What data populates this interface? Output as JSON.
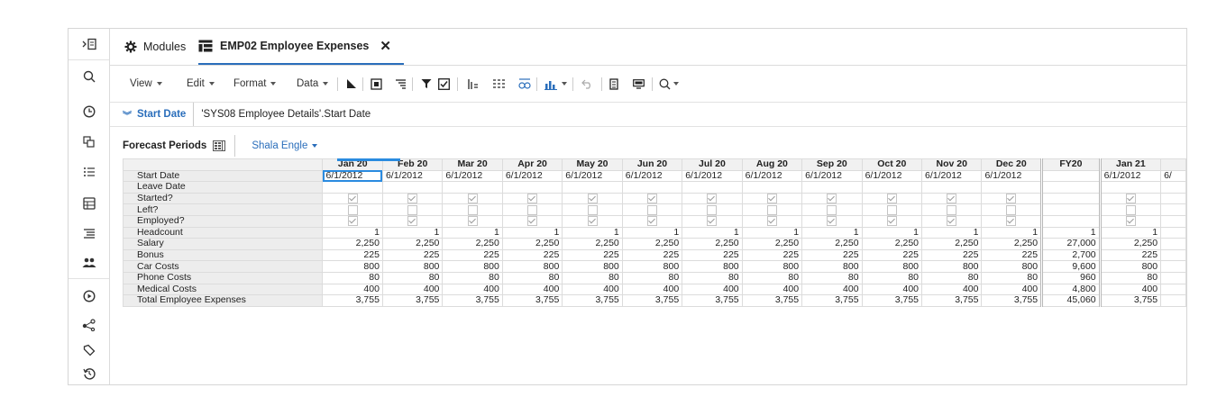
{
  "tabs": [
    {
      "label": "Modules",
      "icon": "gear-icon",
      "active": false
    },
    {
      "label": "EMP02 Employee Expenses",
      "icon": "grid-icon",
      "active": true
    }
  ],
  "toolbar": {
    "menus": [
      "View",
      "Edit",
      "Format",
      "Data"
    ]
  },
  "filter": {
    "label": "Start Date",
    "value": "'SYS08 Employee Details'.Start Date"
  },
  "pagebar": {
    "title": "Forecast Periods",
    "selector": "Shala Engle"
  },
  "grid": {
    "columns": [
      "Jan 20",
      "Feb 20",
      "Mar 20",
      "Apr 20",
      "May 20",
      "Jun 20",
      "Jul 20",
      "Aug 20",
      "Sep 20",
      "Oct 20",
      "Nov 20",
      "Dec 20",
      "FY20",
      "Jan 21",
      ""
    ],
    "rows": [
      {
        "label": "Start Date",
        "type": "text",
        "values": [
          "6/1/2012",
          "6/1/2012",
          "6/1/2012",
          "6/1/2012",
          "6/1/2012",
          "6/1/2012",
          "6/1/2012",
          "6/1/2012",
          "6/1/2012",
          "6/1/2012",
          "6/1/2012",
          "6/1/2012",
          "",
          "6/1/2012",
          "6/"
        ]
      },
      {
        "label": "Leave Date",
        "type": "text",
        "values": [
          "",
          "",
          "",
          "",
          "",
          "",
          "",
          "",
          "",
          "",
          "",
          "",
          "",
          "",
          ""
        ]
      },
      {
        "label": "Started?",
        "type": "check",
        "values": [
          true,
          true,
          true,
          true,
          true,
          true,
          true,
          true,
          true,
          true,
          true,
          true,
          null,
          true,
          null
        ]
      },
      {
        "label": "Left?",
        "type": "check",
        "values": [
          false,
          false,
          false,
          false,
          false,
          false,
          false,
          false,
          false,
          false,
          false,
          false,
          null,
          false,
          null
        ]
      },
      {
        "label": "Employed?",
        "type": "check",
        "values": [
          true,
          true,
          true,
          true,
          true,
          true,
          true,
          true,
          true,
          true,
          true,
          true,
          null,
          true,
          null
        ]
      },
      {
        "label": "Headcount",
        "type": "num",
        "values": [
          "1",
          "1",
          "1",
          "1",
          "1",
          "1",
          "1",
          "1",
          "1",
          "1",
          "1",
          "1",
          "1",
          "1",
          ""
        ]
      },
      {
        "label": "Salary",
        "type": "num",
        "values": [
          "2,250",
          "2,250",
          "2,250",
          "2,250",
          "2,250",
          "2,250",
          "2,250",
          "2,250",
          "2,250",
          "2,250",
          "2,250",
          "2,250",
          "27,000",
          "2,250",
          ""
        ]
      },
      {
        "label": "Bonus",
        "type": "num",
        "values": [
          "225",
          "225",
          "225",
          "225",
          "225",
          "225",
          "225",
          "225",
          "225",
          "225",
          "225",
          "225",
          "2,700",
          "225",
          ""
        ]
      },
      {
        "label": "Car Costs",
        "type": "num",
        "values": [
          "800",
          "800",
          "800",
          "800",
          "800",
          "800",
          "800",
          "800",
          "800",
          "800",
          "800",
          "800",
          "9,600",
          "800",
          ""
        ]
      },
      {
        "label": "Phone Costs",
        "type": "num",
        "values": [
          "80",
          "80",
          "80",
          "80",
          "80",
          "80",
          "80",
          "80",
          "80",
          "80",
          "80",
          "80",
          "960",
          "80",
          ""
        ]
      },
      {
        "label": "Medical Costs",
        "type": "num",
        "values": [
          "400",
          "400",
          "400",
          "400",
          "400",
          "400",
          "400",
          "400",
          "400",
          "400",
          "400",
          "400",
          "4,800",
          "400",
          ""
        ]
      },
      {
        "label": "Total Employee Expenses",
        "type": "num",
        "values": [
          "3,755",
          "3,755",
          "3,755",
          "3,755",
          "3,755",
          "3,755",
          "3,755",
          "3,755",
          "3,755",
          "3,755",
          "3,755",
          "3,755",
          "45,060",
          "3,755",
          ""
        ]
      }
    ]
  },
  "colors": {
    "accent": "#2a6ebb",
    "selection": "#2a8be0"
  }
}
